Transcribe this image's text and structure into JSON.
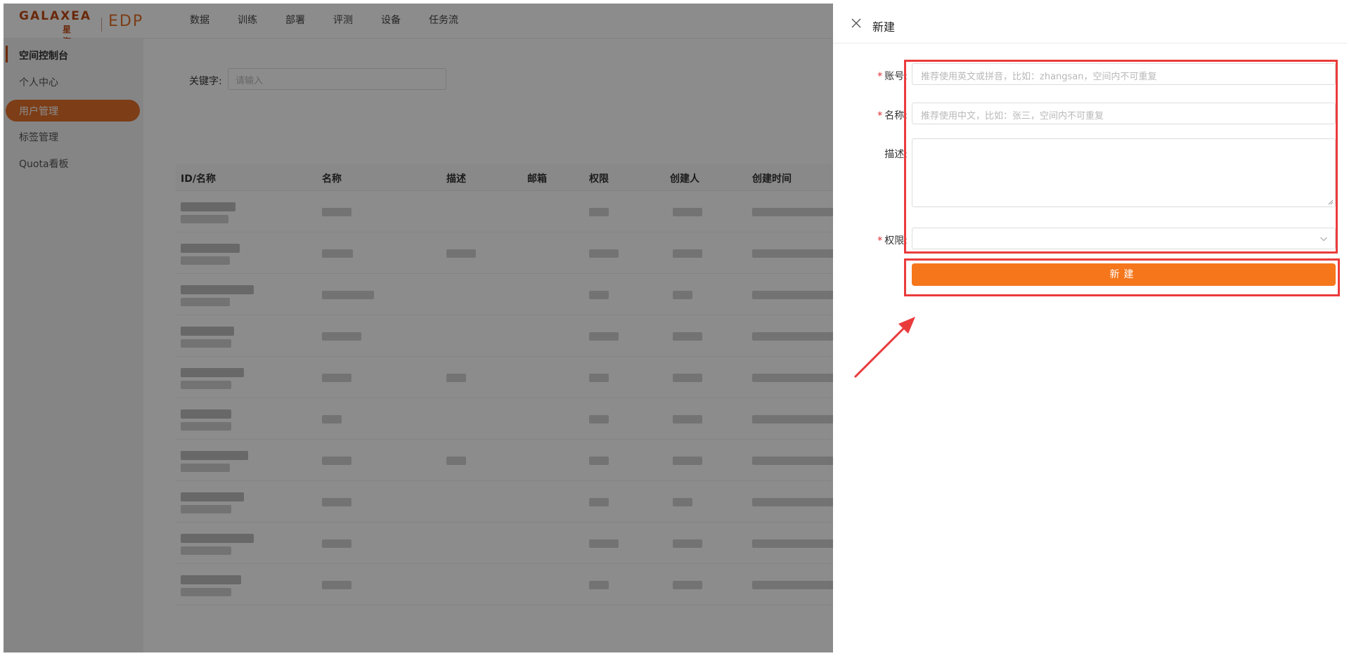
{
  "header": {
    "logo_text": "GALAXEA",
    "logo_cn": "星海图",
    "logo_product": "EDP",
    "nav": [
      "数据",
      "训练",
      "部署",
      "评测",
      "设备",
      "任务流"
    ]
  },
  "sidebar": {
    "group": "空间控制台",
    "items": [
      "个人中心",
      "用户管理",
      "标签管理",
      "Quota看板"
    ],
    "active": "用户管理"
  },
  "filter": {
    "keyword_label": "关键字:",
    "keyword_placeholder": "请输入"
  },
  "table": {
    "columns": [
      "ID/名称",
      "名称",
      "描述",
      "邮箱",
      "权限",
      "创建人",
      "创建时间"
    ],
    "rows_count_visible": 10
  },
  "drawer": {
    "title": "新建",
    "fields": {
      "account": {
        "label": "账号:",
        "placeholder": "推荐使用英文或拼音，比如：zhangsan，空间内不可重复",
        "required": true
      },
      "name": {
        "label": "名称:",
        "placeholder": "推荐使用中文，比如：张三，空间内不可重复",
        "required": true
      },
      "description": {
        "label": "描述:",
        "required": false
      },
      "permission": {
        "label": "权限:",
        "value": "",
        "required": true
      }
    },
    "submit_label": "新建"
  },
  "colors": {
    "accent": "#f5761b",
    "brand": "#c24a14",
    "highlight": "#ea3b3b"
  }
}
